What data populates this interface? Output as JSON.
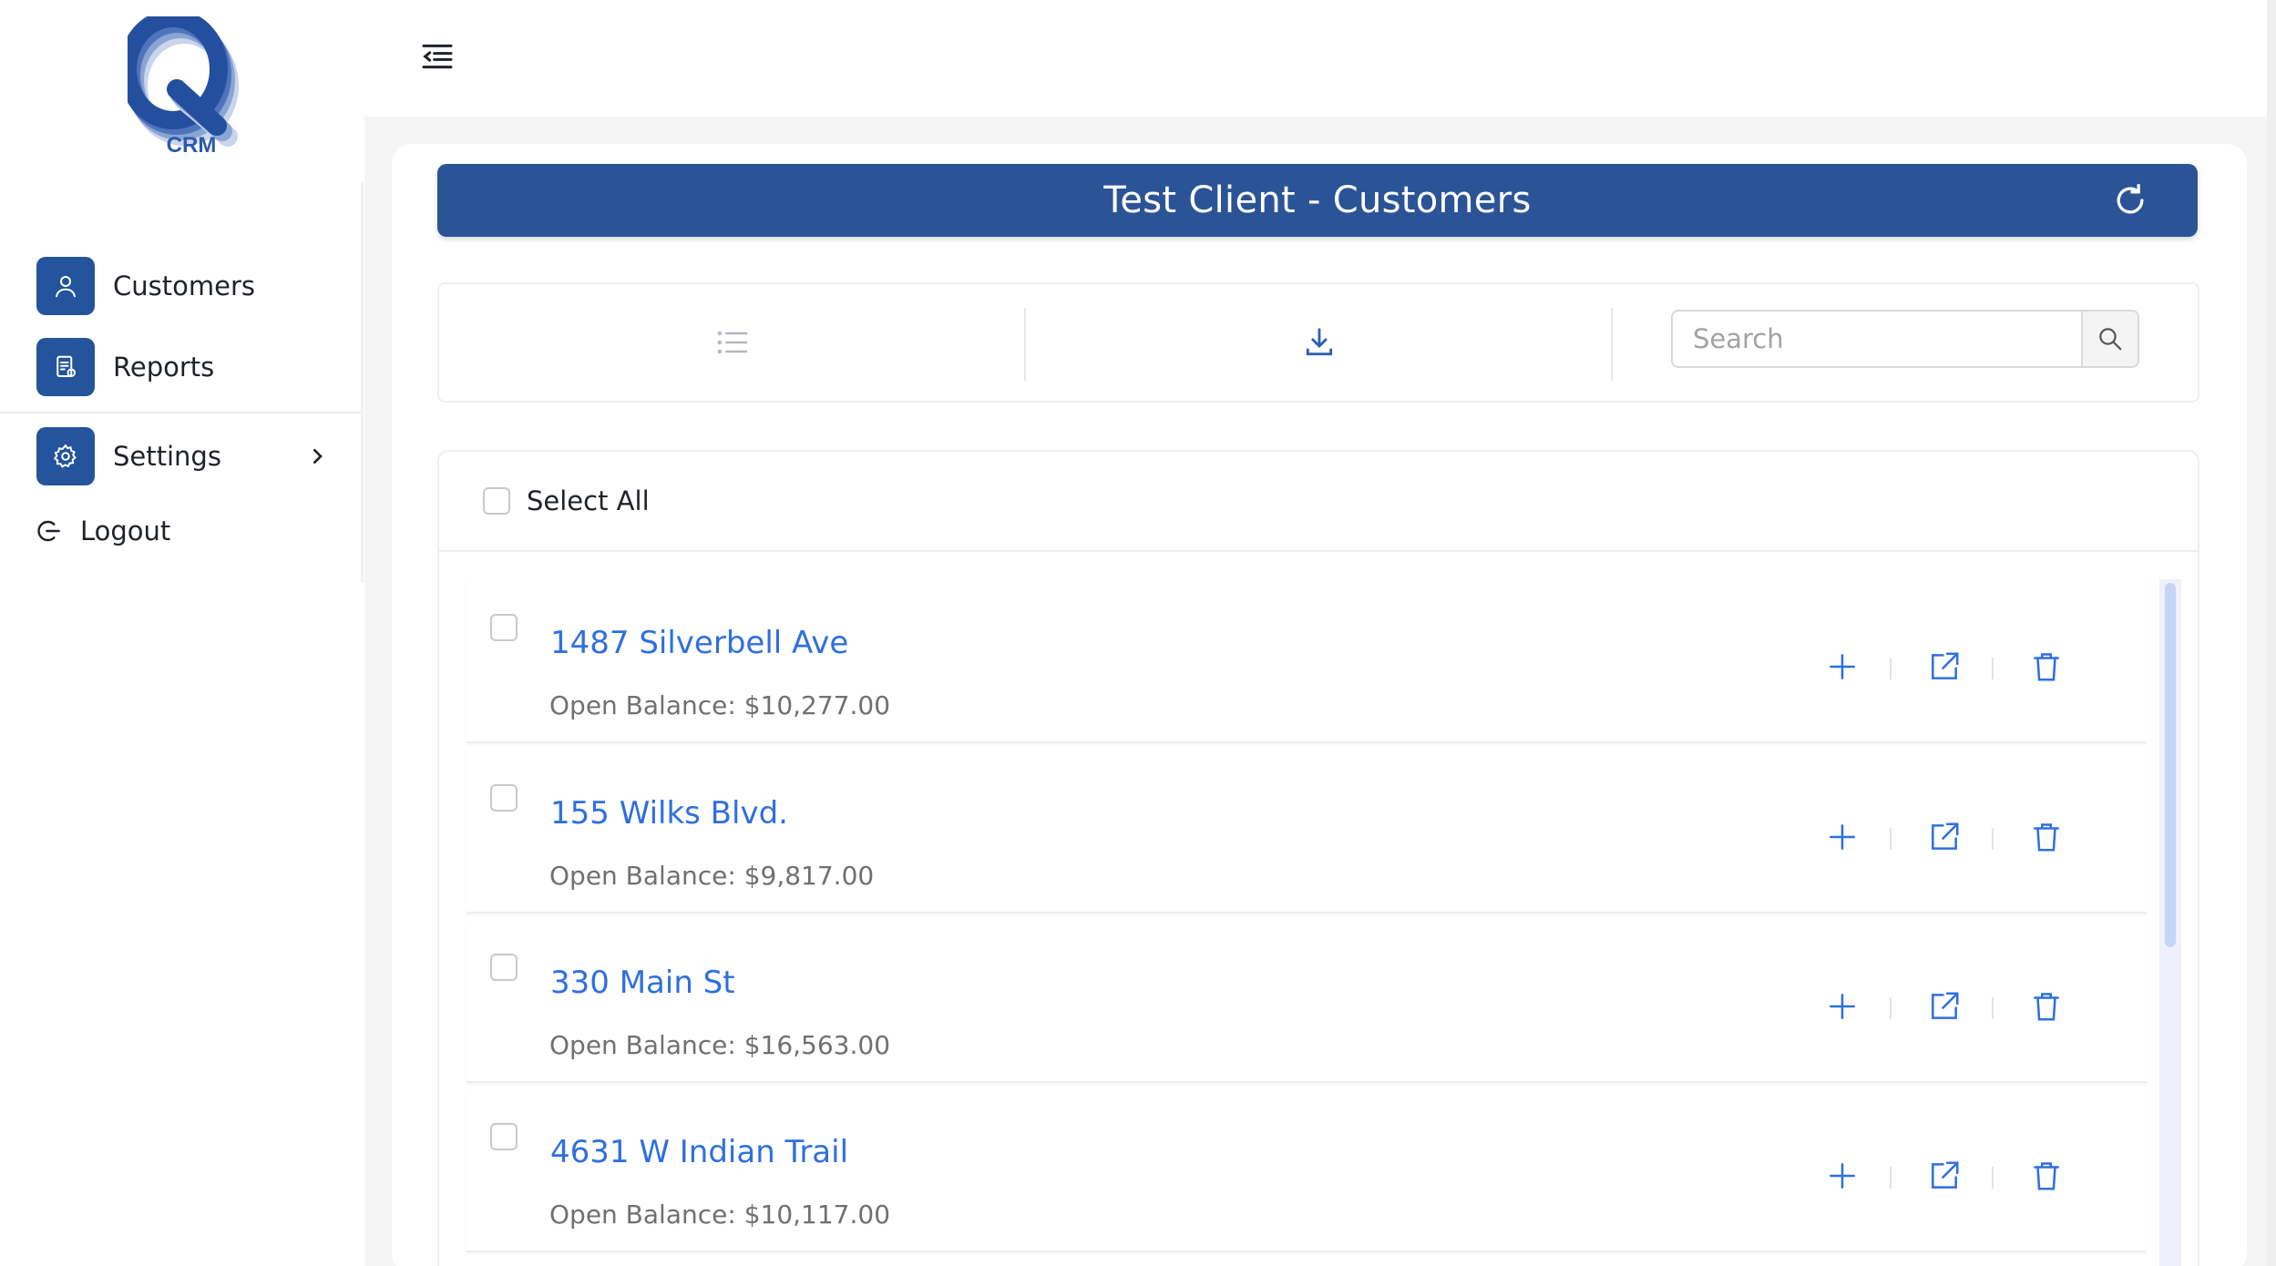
{
  "app": {
    "logo_letter": "Q",
    "logo_text": "CRM",
    "accent_color": "#2b5497",
    "link_color": "#2f6fe0"
  },
  "sidebar": {
    "items": [
      {
        "label": "Customers",
        "icon": "user-icon"
      },
      {
        "label": "Reports",
        "icon": "report-icon"
      },
      {
        "label": "Settings",
        "icon": "gear-icon"
      }
    ],
    "logout_label": "Logout"
  },
  "header": {
    "title": "Test Client - Customers"
  },
  "toolbar": {
    "search_placeholder": "Search"
  },
  "list": {
    "select_all_label": "Select All",
    "customers": [
      {
        "name": "1487 Silverbell Ave",
        "balance": "Open Balance: $10,277.00"
      },
      {
        "name": "155 Wilks Blvd.",
        "balance": "Open Balance: $9,817.00"
      },
      {
        "name": "330 Main St",
        "balance": "Open Balance: $16,563.00"
      },
      {
        "name": "4631 W Indian Trail",
        "balance": "Open Balance: $10,117.00"
      }
    ]
  }
}
